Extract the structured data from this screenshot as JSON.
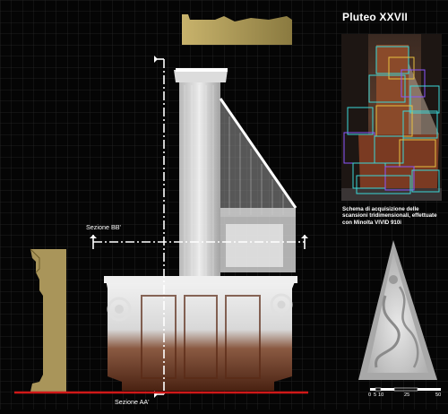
{
  "title": "Pluteo XXVII",
  "caption": "Schema di acquisizione delle scansioni tridimensionali, effettuate con Minolta VIVID 910i",
  "sections": {
    "bb_label": "Sezione BB'",
    "aa_label": "Sezione AA'"
  },
  "scale_bar": {
    "ticks": [
      "0",
      "5",
      "10",
      "25",
      "50"
    ]
  },
  "colors": {
    "background": "#050505",
    "grid": "#2a2a2a",
    "section_profile": "#a9955a",
    "base_line": "#d01818",
    "scan_box_cyan": "#3ad8d8",
    "scan_box_purple": "#8a55ff",
    "scan_box_yellow": "#e8c040",
    "wood": "#7a3a22"
  }
}
